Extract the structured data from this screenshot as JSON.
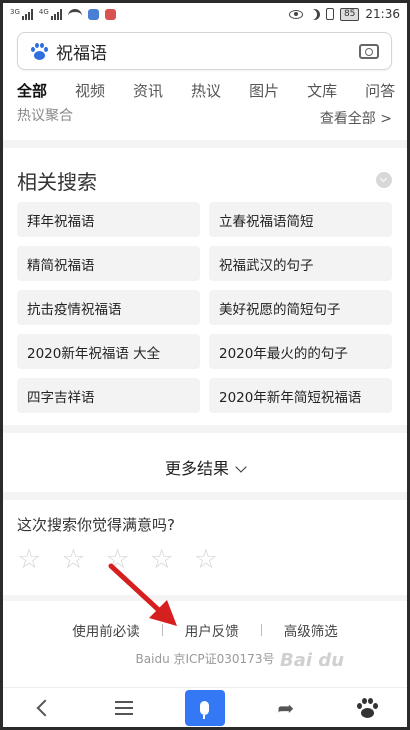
{
  "status_bar": {
    "sig1_tag": "3G",
    "sig2_tag": "4G",
    "battery": "85",
    "time": "21:36"
  },
  "search": {
    "query": "祝福语",
    "icons": [
      "baidu-paw-icon",
      "camera-icon"
    ]
  },
  "tabs": [
    "全部",
    "视频",
    "资讯",
    "热议",
    "图片",
    "文库",
    "问答"
  ],
  "hot_section": {
    "label": "热议聚合",
    "more": "查看全部"
  },
  "related": {
    "title": "相关搜索",
    "items": [
      "拜年祝福语",
      "立春祝福语简短",
      "精简祝福语",
      "祝福武汉的句子",
      "抗击疫情祝福语",
      "美好祝愿的简短句子",
      "2020新年祝福语 大全",
      "2020年最火的的句子",
      "四字吉祥语",
      "2020年新年简短祝福语"
    ]
  },
  "more_results": "更多结果",
  "satisfaction": {
    "question": "这次搜索你觉得满意吗?",
    "stars": 5
  },
  "footer": {
    "links": [
      "使用前必读",
      "用户反馈",
      "高级筛选"
    ],
    "icp": "Baidu 京ICP证030173号"
  },
  "watermark": "Bai du",
  "colors": {
    "accent": "#3478f6",
    "annotation_arrow": "#d62020"
  }
}
